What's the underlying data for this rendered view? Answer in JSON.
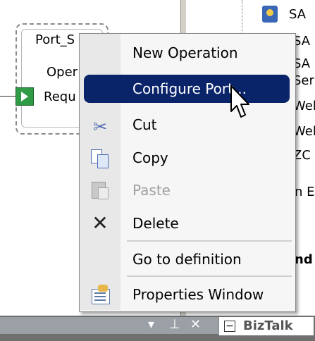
{
  "canvas": {
    "port": {
      "title": "Port_S",
      "operation": "Oper",
      "request": "Requ"
    },
    "right_list": {
      "items": [
        "SA",
        "SA",
        "SA",
        "Ser",
        "Wel",
        "Wel",
        "ZC",
        "n E",
        "nd"
      ]
    }
  },
  "context_menu": {
    "items": [
      {
        "label": "New Operation",
        "icon": "",
        "state": "normal"
      },
      {
        "label": "Configure Port...",
        "icon": "",
        "state": "selected"
      },
      {
        "label": "Cut",
        "icon": "scissors-icon",
        "state": "normal"
      },
      {
        "label": "Copy",
        "icon": "copy-icon",
        "state": "normal"
      },
      {
        "label": "Paste",
        "icon": "paste-icon",
        "state": "disabled"
      },
      {
        "label": "Delete",
        "icon": "delete-x-icon",
        "state": "normal"
      },
      {
        "label": "Go to definition",
        "icon": "",
        "state": "normal"
      },
      {
        "label": "Properties Window",
        "icon": "properties-icon",
        "state": "normal"
      }
    ]
  },
  "bottom_bar": {
    "biztalk_label": "BizTalk",
    "dropdown_glyph": "▾",
    "pin_glyph": "⊥",
    "close_glyph": "✕",
    "collapse_glyph": "−"
  },
  "colors": {
    "menu_highlight": "#0a246a",
    "menu_gutter": "#e8e8e8",
    "menu_background": "#f6f6f6"
  }
}
